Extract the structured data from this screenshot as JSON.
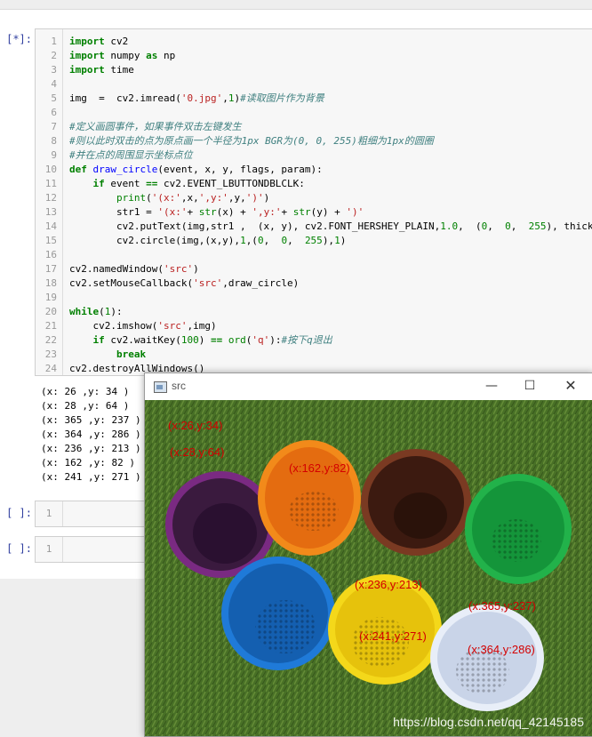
{
  "cell_main": {
    "prompt": "[*]:"
  },
  "code_lines": [
    {
      "n": "1",
      "code": [
        {
          "t": "import",
          "c": "kw"
        },
        {
          "t": " cv2",
          "c": ""
        }
      ]
    },
    {
      "n": "2",
      "code": [
        {
          "t": "import",
          "c": "kw"
        },
        {
          "t": " numpy ",
          "c": ""
        },
        {
          "t": "as",
          "c": "kw"
        },
        {
          "t": " np",
          "c": ""
        }
      ]
    },
    {
      "n": "3",
      "code": [
        {
          "t": "import",
          "c": "kw"
        },
        {
          "t": " time",
          "c": ""
        }
      ]
    },
    {
      "n": "4",
      "code": []
    },
    {
      "n": "5",
      "code": [
        {
          "t": "img  =  cv2.imread(",
          "c": ""
        },
        {
          "t": "'0.jpg'",
          "c": "str"
        },
        {
          "t": ",",
          "c": ""
        },
        {
          "t": "1",
          "c": "num"
        },
        {
          "t": ")",
          "c": ""
        },
        {
          "t": "#读取图片作为背景",
          "c": "cm"
        }
      ]
    },
    {
      "n": "6",
      "code": []
    },
    {
      "n": "7",
      "code": [
        {
          "t": "#定义画圆事件，如果事件双击左键发生",
          "c": "cm"
        }
      ]
    },
    {
      "n": "8",
      "code": [
        {
          "t": "#则以此时双击的点为原点画一个半径为1px BGR为(0, 0, 255)粗细为1px的圆圈",
          "c": "cm"
        }
      ]
    },
    {
      "n": "9",
      "code": [
        {
          "t": "#并在点的周围显示坐标点位",
          "c": "cm"
        }
      ]
    },
    {
      "n": "10",
      "code": [
        {
          "t": "def",
          "c": "kw"
        },
        {
          "t": " ",
          "c": ""
        },
        {
          "t": "draw_circle",
          "c": "fn"
        },
        {
          "t": "(event, x, y, flags, param):",
          "c": ""
        }
      ]
    },
    {
      "n": "11",
      "code": [
        {
          "t": "    ",
          "c": ""
        },
        {
          "t": "if",
          "c": "kw"
        },
        {
          "t": " event ",
          "c": ""
        },
        {
          "t": "==",
          "c": "kw"
        },
        {
          "t": " cv2.EVENT_LBUTTONDBLCLK:",
          "c": ""
        }
      ]
    },
    {
      "n": "12",
      "code": [
        {
          "t": "        ",
          "c": ""
        },
        {
          "t": "print",
          "c": "num"
        },
        {
          "t": "(",
          "c": ""
        },
        {
          "t": "'(x:'",
          "c": "str"
        },
        {
          "t": ",x,",
          "c": ""
        },
        {
          "t": "',y:'",
          "c": "str"
        },
        {
          "t": ",y,",
          "c": ""
        },
        {
          "t": "')'",
          "c": "str"
        },
        {
          "t": ")",
          "c": ""
        }
      ]
    },
    {
      "n": "13",
      "code": [
        {
          "t": "        str1 = ",
          "c": ""
        },
        {
          "t": "'(x:'",
          "c": "str"
        },
        {
          "t": "+ ",
          "c": ""
        },
        {
          "t": "str",
          "c": "num"
        },
        {
          "t": "(x) + ",
          "c": ""
        },
        {
          "t": "',y:'",
          "c": "str"
        },
        {
          "t": "+ ",
          "c": ""
        },
        {
          "t": "str",
          "c": "num"
        },
        {
          "t": "(y) + ",
          "c": ""
        },
        {
          "t": "')'",
          "c": "str"
        }
      ]
    },
    {
      "n": "14",
      "code": [
        {
          "t": "        cv2.putText(img,str1 ,  (x, y), cv2.FONT_HERSHEY_PLAIN,",
          "c": ""
        },
        {
          "t": "1.0",
          "c": "num"
        },
        {
          "t": ",  (",
          "c": ""
        },
        {
          "t": "0",
          "c": "num"
        },
        {
          "t": ",  ",
          "c": ""
        },
        {
          "t": "0",
          "c": "num"
        },
        {
          "t": ",  ",
          "c": ""
        },
        {
          "t": "255",
          "c": "num"
        },
        {
          "t": "), thickness",
          "c": ""
        }
      ]
    },
    {
      "n": "15",
      "code": [
        {
          "t": "        cv2.circle(img,(x,y),",
          "c": ""
        },
        {
          "t": "1",
          "c": "num"
        },
        {
          "t": ",(",
          "c": ""
        },
        {
          "t": "0",
          "c": "num"
        },
        {
          "t": ",  ",
          "c": ""
        },
        {
          "t": "0",
          "c": "num"
        },
        {
          "t": ",  ",
          "c": ""
        },
        {
          "t": "255",
          "c": "num"
        },
        {
          "t": "),",
          "c": ""
        },
        {
          "t": "1",
          "c": "num"
        },
        {
          "t": ")",
          "c": ""
        }
      ]
    },
    {
      "n": "16",
      "code": []
    },
    {
      "n": "17",
      "code": [
        {
          "t": "cv2.namedWindow(",
          "c": ""
        },
        {
          "t": "'src'",
          "c": "str"
        },
        {
          "t": ")",
          "c": ""
        }
      ]
    },
    {
      "n": "18",
      "code": [
        {
          "t": "cv2.setMouseCallback(",
          "c": ""
        },
        {
          "t": "'src'",
          "c": "str"
        },
        {
          "t": ",draw_circle)",
          "c": ""
        }
      ]
    },
    {
      "n": "19",
      "code": []
    },
    {
      "n": "20",
      "code": [
        {
          "t": "while",
          "c": "kw"
        },
        {
          "t": "(",
          "c": ""
        },
        {
          "t": "1",
          "c": "num"
        },
        {
          "t": "):",
          "c": ""
        }
      ]
    },
    {
      "n": "21",
      "code": [
        {
          "t": "    cv2.imshow(",
          "c": ""
        },
        {
          "t": "'src'",
          "c": "str"
        },
        {
          "t": ",img)",
          "c": ""
        }
      ]
    },
    {
      "n": "22",
      "code": [
        {
          "t": "    ",
          "c": ""
        },
        {
          "t": "if",
          "c": "kw"
        },
        {
          "t": " cv2.waitKey(",
          "c": ""
        },
        {
          "t": "100",
          "c": "num"
        },
        {
          "t": ") ",
          "c": ""
        },
        {
          "t": "==",
          "c": "kw"
        },
        {
          "t": " ",
          "c": ""
        },
        {
          "t": "ord",
          "c": "num"
        },
        {
          "t": "(",
          "c": ""
        },
        {
          "t": "'q'",
          "c": "str"
        },
        {
          "t": "):",
          "c": ""
        },
        {
          "t": "#按下q退出",
          "c": "cm"
        }
      ]
    },
    {
      "n": "23",
      "code": [
        {
          "t": "        ",
          "c": ""
        },
        {
          "t": "break",
          "c": "kw"
        }
      ]
    },
    {
      "n": "24",
      "code": [
        {
          "t": "cv2.destroyAllWindows()",
          "c": ""
        }
      ]
    }
  ],
  "output_lines": [
    "(x: 26 ,y: 34 )",
    "(x: 28 ,y: 64 )",
    "(x: 365 ,y: 237 )",
    "(x: 364 ,y: 286 )",
    "(x: 236 ,y: 213 )",
    "(x: 162 ,y: 82 )",
    "(x: 241 ,y: 271 )"
  ],
  "empty_cells": [
    {
      "prompt": "[ ]:",
      "line": "1"
    },
    {
      "prompt": "[ ]:",
      "line": "1"
    }
  ],
  "window": {
    "title": "src",
    "minimize_icon": "minimize-icon",
    "maximize_icon": "maximize-icon",
    "close_icon": "close-icon",
    "labels": [
      "(x:26,y:34)",
      "(x:28,y:64)",
      "(x:162,y:82)",
      "(x:236,y:213)",
      "(x:365,y:237)",
      "(x:241,y:271)",
      "(x:364,y:286)"
    ],
    "watermark": "https://blog.csdn.net/qq_42145185"
  }
}
